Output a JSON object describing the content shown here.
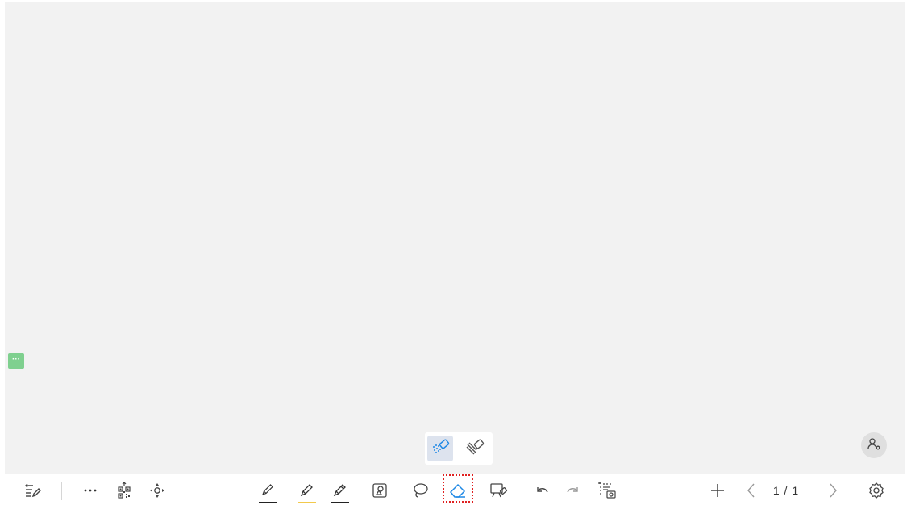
{
  "side_tab": {
    "label": "···"
  },
  "pagination": {
    "current": "1 / 1"
  },
  "colors": {
    "canvas": "#f2f2f2",
    "accent": "#1e88e5",
    "side_tab": "#7fd08f",
    "pen_black": "#222222",
    "highlighter_yellow": "#f2c94c",
    "selection_outline": "#e02020"
  },
  "toolbar": {
    "left": [
      {
        "icon": "menu-edit-icon"
      },
      {
        "icon": "more-icon"
      },
      {
        "icon": "qr-code-icon"
      },
      {
        "icon": "move-icon"
      }
    ],
    "center": [
      {
        "icon": "pen-icon"
      },
      {
        "icon": "highlighter-icon"
      },
      {
        "icon": "marker-icon"
      },
      {
        "icon": "shapes-icon"
      },
      {
        "icon": "lasso-icon"
      },
      {
        "icon": "eraser-icon",
        "selected": true
      },
      {
        "icon": "board-eraser-icon"
      },
      {
        "icon": "undo-icon"
      },
      {
        "icon": "redo-icon"
      },
      {
        "icon": "capture-icon"
      }
    ],
    "right": [
      {
        "icon": "add-page-icon"
      },
      {
        "icon": "prev-page-icon"
      },
      {
        "icon": "next-page-icon"
      },
      {
        "icon": "settings-icon"
      }
    ]
  },
  "eraser_popup": {
    "options": [
      {
        "icon": "point-eraser-icon",
        "active": true
      },
      {
        "icon": "stroke-eraser-icon",
        "active": false
      }
    ]
  }
}
